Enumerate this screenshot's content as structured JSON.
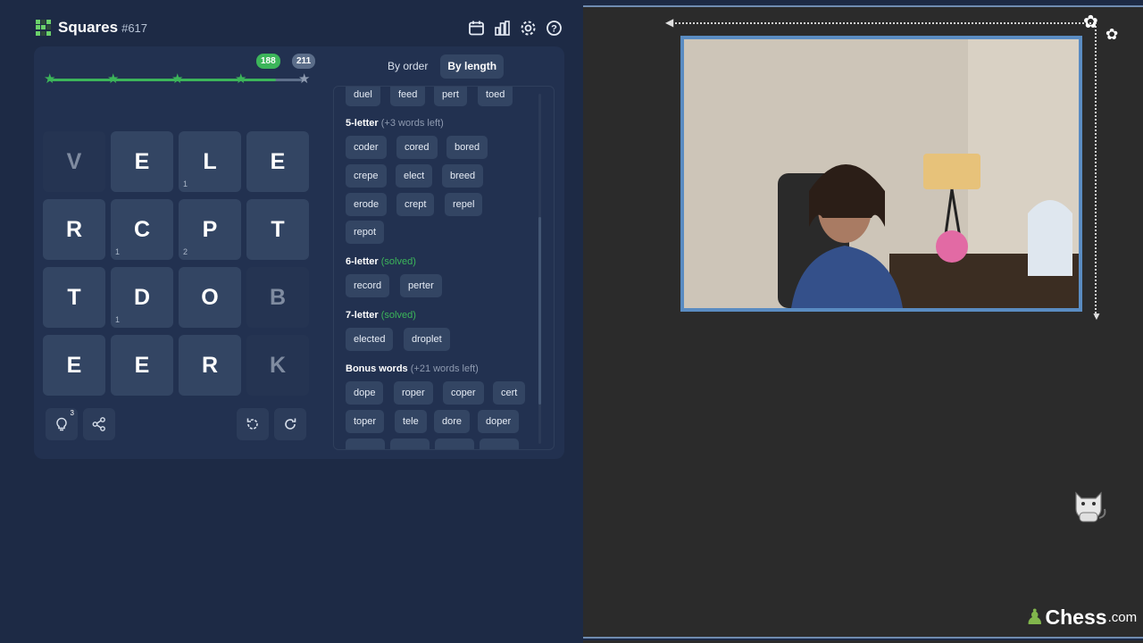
{
  "header": {
    "title": "Squares",
    "puzzle_number": "#617",
    "icons": [
      "calendar-icon",
      "stats-icon",
      "settings-icon",
      "help-icon"
    ]
  },
  "progress": {
    "current_score": "188",
    "max_score": "211",
    "fraction": 0.89
  },
  "grid": [
    {
      "letter": "V",
      "hint": "",
      "dim": true
    },
    {
      "letter": "E",
      "hint": "",
      "dim": false
    },
    {
      "letter": "L",
      "hint": "1",
      "dim": false
    },
    {
      "letter": "E",
      "hint": "",
      "dim": false
    },
    {
      "letter": "R",
      "hint": "",
      "dim": false
    },
    {
      "letter": "C",
      "hint": "1",
      "dim": false
    },
    {
      "letter": "P",
      "hint": "2",
      "dim": false
    },
    {
      "letter": "T",
      "hint": "",
      "dim": false
    },
    {
      "letter": "T",
      "hint": "",
      "dim": false
    },
    {
      "letter": "D",
      "hint": "1",
      "dim": false
    },
    {
      "letter": "O",
      "hint": "",
      "dim": false
    },
    {
      "letter": "B",
      "hint": "",
      "dim": true
    },
    {
      "letter": "E",
      "hint": "",
      "dim": false
    },
    {
      "letter": "E",
      "hint": "",
      "dim": false
    },
    {
      "letter": "R",
      "hint": "",
      "dim": false
    },
    {
      "letter": "K",
      "hint": "",
      "dim": true
    }
  ],
  "controls": {
    "hint_count": "3"
  },
  "tabs": {
    "by_order": "By order",
    "by_length": "By length"
  },
  "words": {
    "partial_row": [
      "duel",
      "feed",
      "pert",
      "toed"
    ],
    "five": {
      "label": "5-letter",
      "status": "(+3 words left)",
      "items": [
        "coder",
        "cored",
        "bored",
        "crepe",
        "elect",
        "breed",
        "erode",
        "crept",
        "repel",
        "repot"
      ]
    },
    "six": {
      "label": "6-letter",
      "status": "(solved)",
      "items": [
        "record",
        "perter"
      ]
    },
    "seven": {
      "label": "7-letter",
      "status": "(solved)",
      "items": [
        "elected",
        "droplet"
      ]
    },
    "bonus": {
      "label": "Bonus words",
      "status": "(+21 words left)",
      "items": [
        "dope",
        "roper",
        "coper",
        "cert",
        "toper",
        "tele",
        "dore",
        "doper"
      ]
    }
  },
  "brand": {
    "name": "Chess",
    "suffix": ".com"
  },
  "colors": {
    "panel_bg": "#1d2a45",
    "tile": "#334563",
    "accent_green": "#3cb55a",
    "stream_border": "#5a8cc2"
  }
}
